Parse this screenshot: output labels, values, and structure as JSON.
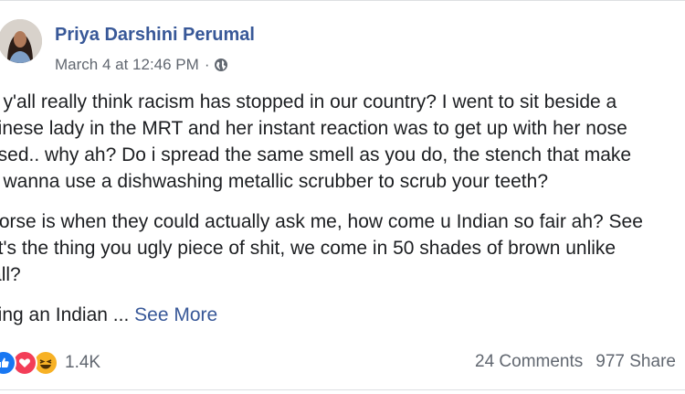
{
  "post": {
    "author": "Priya Darshini Perumal",
    "timestamp": "March 4 at 12:46 PM",
    "separator": "·",
    "privacy_icon": "globe-icon",
    "paragraphs": [
      "o y'all really think racism has stopped in our country? I went to sit beside a",
      "hinese lady in the MRT and her instant reaction was to get up with her nose",
      "osed.. why ah? Do i spread the same smell as you do, the stench that make",
      "e wanna use a dishwashing metallic scrubber to scrub your teeth?",
      "Vorse is when they could actually ask me, how come u Indian so fair ah? See",
      "at's the thing you ugly piece of shit, we come in 50 shades of brown unlike",
      "'all?",
      "eing an Indian ..."
    ],
    "see_more": "See More"
  },
  "footer": {
    "reaction_icons": [
      "like-icon",
      "love-icon",
      "haha-icon"
    ],
    "reaction_count": "1.4K",
    "comments": "24 Comments",
    "shares": "977 Share"
  },
  "colors": {
    "link": "#385898",
    "meta": "#616770",
    "like": "#1877f2",
    "love": "#f33e58",
    "haha": "#f7b125"
  }
}
